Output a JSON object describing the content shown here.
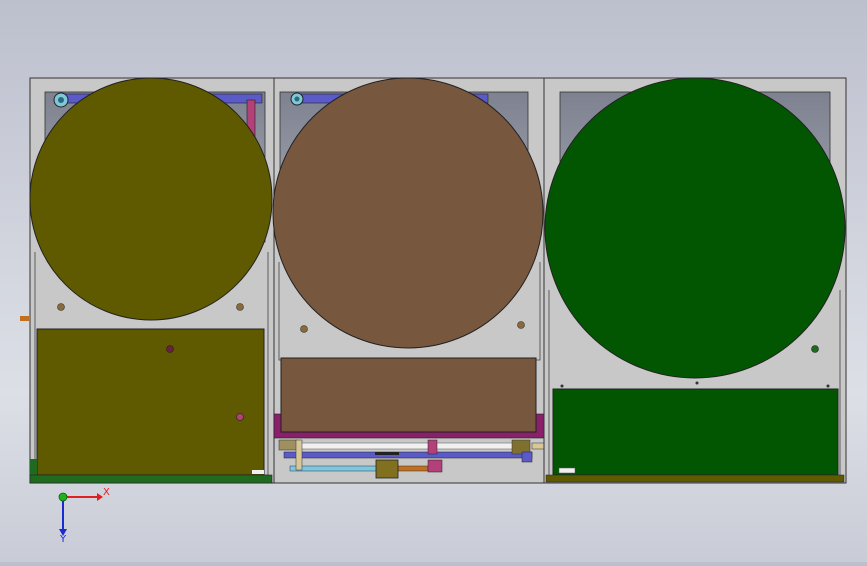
{
  "triad": {
    "x_label": "X",
    "y_label": "Y",
    "x_color": "#e02020",
    "y_color": "#20b020",
    "z_color": "#1a2bd0"
  },
  "colors": {
    "housing": "#c8c8c8",
    "cavity": "#8c909a",
    "left_disc": "#5f5a00",
    "middle_disc": "#77573e",
    "right_disc": "#025602",
    "pipe_blue": "#5a5ac8",
    "pipe_cyan": "#7ec8d8",
    "pipe_magenta": "#b4407a",
    "pipe_white": "#f0f0f0",
    "pipe_orange": "#c07020",
    "base_green": "#1f6a1f"
  },
  "components": [
    {
      "id": "left-unit",
      "disc_color": "#5f5a00",
      "plate_color": "#5f5a00"
    },
    {
      "id": "middle-unit",
      "disc_color": "#77573e",
      "plate_color": "#77573e"
    },
    {
      "id": "right-unit",
      "disc_color": "#025602",
      "plate_color": "#025602"
    }
  ]
}
